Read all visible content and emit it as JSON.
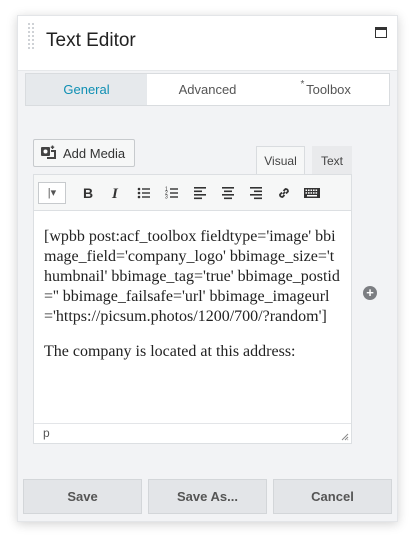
{
  "header": {
    "title": "Text Editor"
  },
  "tabs": [
    {
      "label": "General",
      "active": true
    },
    {
      "label": "Advanced",
      "active": false
    },
    {
      "label": "Toolbox",
      "active": false,
      "marker": "*"
    }
  ],
  "editor": {
    "add_media_label": "Add Media",
    "mode_tabs": {
      "visual": "Visual",
      "text": "Text"
    },
    "toolbar": [
      "format-select",
      "bold-icon",
      "italic-icon",
      "bullet-list-icon",
      "numbered-list-icon",
      "align-left-icon",
      "align-center-icon",
      "align-right-icon",
      "link-icon",
      "keyboard-icon"
    ],
    "paragraphs": [
      "[wpbb post:acf_toolbox fieldtype='image' bbimage_field='company_logo' bbimage_size='thumbnail' bbimage_tag='true' bbimage_postid='' bbimage_failsafe='url' bbimage_imageurl='https://picsum.photos/1200/700/?random']",
      "The company is located at this address:"
    ],
    "status_path": "p"
  },
  "footer": {
    "save_label": "Save",
    "save_as_label": "Save As...",
    "cancel_label": "Cancel"
  },
  "colors": {
    "accent": "#0e8fb3",
    "panel_bg": "#f2f3f5"
  }
}
